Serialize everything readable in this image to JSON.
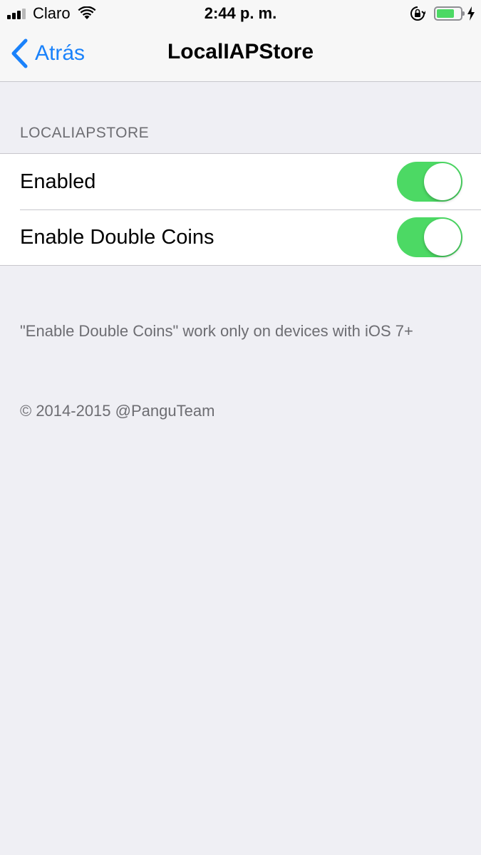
{
  "status_bar": {
    "carrier": "Claro",
    "time": "2:44 p. m.",
    "battery_level": 0.75,
    "battery_color": "#4cd964"
  },
  "nav": {
    "back_label": "Atrás",
    "title": "LocalIAPStore"
  },
  "section": {
    "header": "LOCALIAPSTORE",
    "rows": [
      {
        "label": "Enabled",
        "toggle_on": true
      },
      {
        "label": "Enable Double Coins",
        "toggle_on": true
      }
    ],
    "footer_note": "\"Enable Double Coins\" work only on devices with iOS 7+"
  },
  "copyright": "© 2014-2015 @PanguTeam",
  "colors": {
    "accent": "#1a82fb",
    "toggle_on": "#4cd964",
    "background": "#efeff4"
  }
}
